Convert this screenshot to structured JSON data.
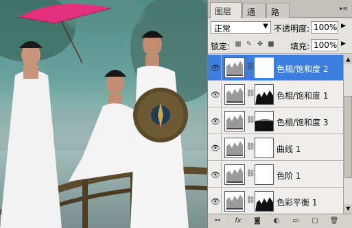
{
  "tabs": [
    {
      "label": "图层",
      "close": "×"
    },
    {
      "label": "通道"
    },
    {
      "label": "路径"
    }
  ],
  "panel_menu_icon": "▸≡",
  "blend": {
    "mode": "正常",
    "opacity_label": "不透明度:",
    "opacity": "100%"
  },
  "lock": {
    "label": "锁定:",
    "fill_label": "填充:",
    "fill": "100%"
  },
  "layers": [
    {
      "name": "色相/饱和度 2",
      "selected": true,
      "mask": "white"
    },
    {
      "name": "色相/饱和度 1",
      "selected": false,
      "mask": "silhouette"
    },
    {
      "name": "色相/饱和度 3",
      "selected": false,
      "mask": "dark-bottom"
    },
    {
      "name": "曲线 1",
      "selected": false,
      "mask": "white"
    },
    {
      "name": "色阶 1",
      "selected": false,
      "mask": "white"
    },
    {
      "name": "色彩平衡 1",
      "selected": false,
      "mask": "silhouette"
    }
  ],
  "icons": {
    "eye": "eye-icon",
    "chain": "chain-link-icon",
    "bottom": [
      "link-layers-icon",
      "fx-icon",
      "add-mask-icon",
      "adjustment-layer-icon",
      "new-group-icon",
      "new-layer-icon",
      "trash-icon"
    ]
  },
  "bottom_labels": {
    "link": "⚯",
    "fx": "fx",
    "mask": "◙",
    "adjust": "◐",
    "group": "▭",
    "new": "▢",
    "trash": "🗑"
  },
  "colors": {
    "selected": "#3a7fe0",
    "panel": "#d6d3ce"
  }
}
